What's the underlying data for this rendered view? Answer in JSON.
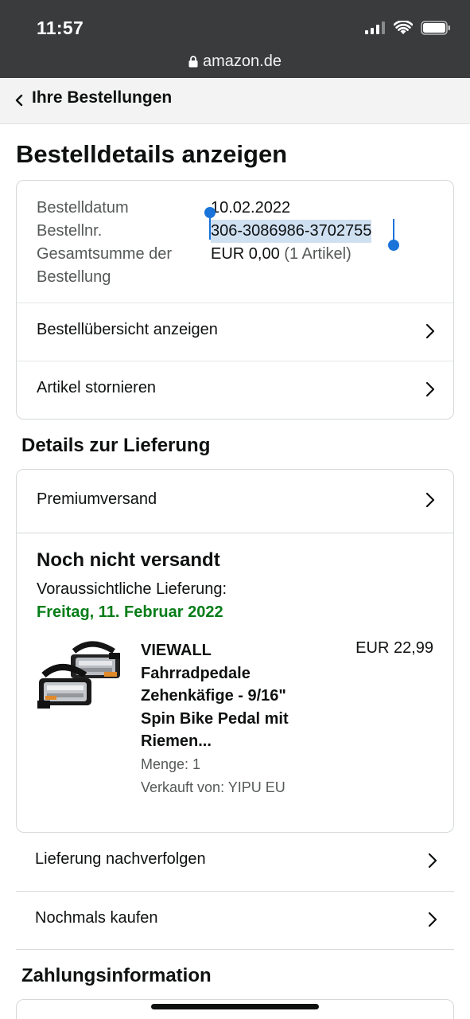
{
  "status_bar": {
    "time": "11:57",
    "url": "amazon.de"
  },
  "nav": {
    "back_label": "Ihre Bestellungen"
  },
  "page": {
    "title": "Bestelldetails anzeigen"
  },
  "order_summary": {
    "date_label": "Bestelldatum",
    "date_value": "10.02.2022",
    "number_label": "Bestellnr.",
    "number_value": "306-3086986-3702755",
    "total_label_line1": "Gesamtsumme der",
    "total_label_line2": "Bestellung",
    "total_value": "EUR 0,00",
    "total_items": "(1 Artikel)"
  },
  "order_actions": {
    "view_summary": "Bestellübersicht anzeigen",
    "cancel_items": "Artikel stornieren"
  },
  "delivery": {
    "section_title": "Details zur Lieferung",
    "shipping_method": "Premiumversand",
    "status": "Noch nicht versandt",
    "eta_label": "Voraussichtliche Lieferung:",
    "eta_date": "Freitag, 11. Februar 2022",
    "eta_color": "#067d18",
    "item": {
      "title_lines": [
        "VIEWALL",
        "Fahrradpedale",
        "Zehenkäfige - 9/16\"",
        "Spin Bike Pedal mit",
        "Riemen..."
      ],
      "price": "EUR 22,99",
      "quantity": "Menge: 1",
      "seller": "Verkauft von: YIPU EU"
    }
  },
  "more_actions": {
    "track": "Lieferung nachverfolgen",
    "buy_again": "Nochmals kaufen"
  },
  "payment": {
    "section_title": "Zahlungsinformation"
  },
  "colors": {
    "status_bar_bg": "#3a3b3d",
    "selection": "#cfe0f1",
    "selection_handle": "#1a73d9"
  }
}
